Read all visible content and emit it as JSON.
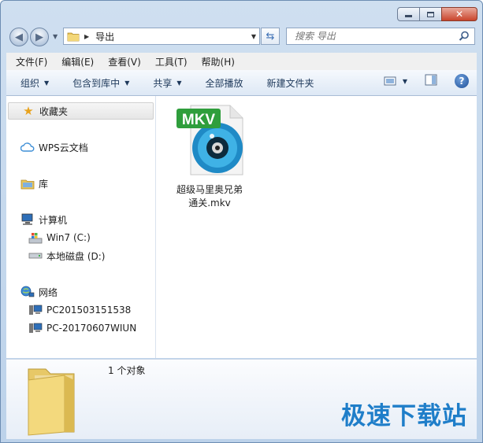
{
  "window": {
    "caption_buttons": {
      "minimize_icon": "minimize-icon",
      "maximize_icon": "maximize-icon",
      "close_icon": "close-icon"
    }
  },
  "address": {
    "path": "导出",
    "search_placeholder": "搜索 导出"
  },
  "menu": [
    "文件(F)",
    "编辑(E)",
    "查看(V)",
    "工具(T)",
    "帮助(H)"
  ],
  "toolbar": {
    "organize": "组织",
    "include_in_library": "包含到库中",
    "share": "共享",
    "play_all": "全部播放",
    "new_folder": "新建文件夹"
  },
  "nav": {
    "favorites": "收藏夹",
    "wps": "WPS云文档",
    "libraries": "库",
    "computer": "计算机",
    "drive_c": "Win7 (C:)",
    "drive_d": "本地磁盘 (D:)",
    "network": "网络",
    "pc1": "PC201503151538",
    "pc2": "PC-20170607WIUN"
  },
  "file": {
    "badge": "MKV",
    "name_line1": "超级马里奥兄弟",
    "name_line2": "通关.mkv"
  },
  "details": {
    "count": "1 个对象"
  },
  "watermark": "极速下载站",
  "colors": {
    "accent": "#1f7ec9",
    "toolbar_text": "#1e395b",
    "mkv_badge": "#2f9e3c"
  }
}
